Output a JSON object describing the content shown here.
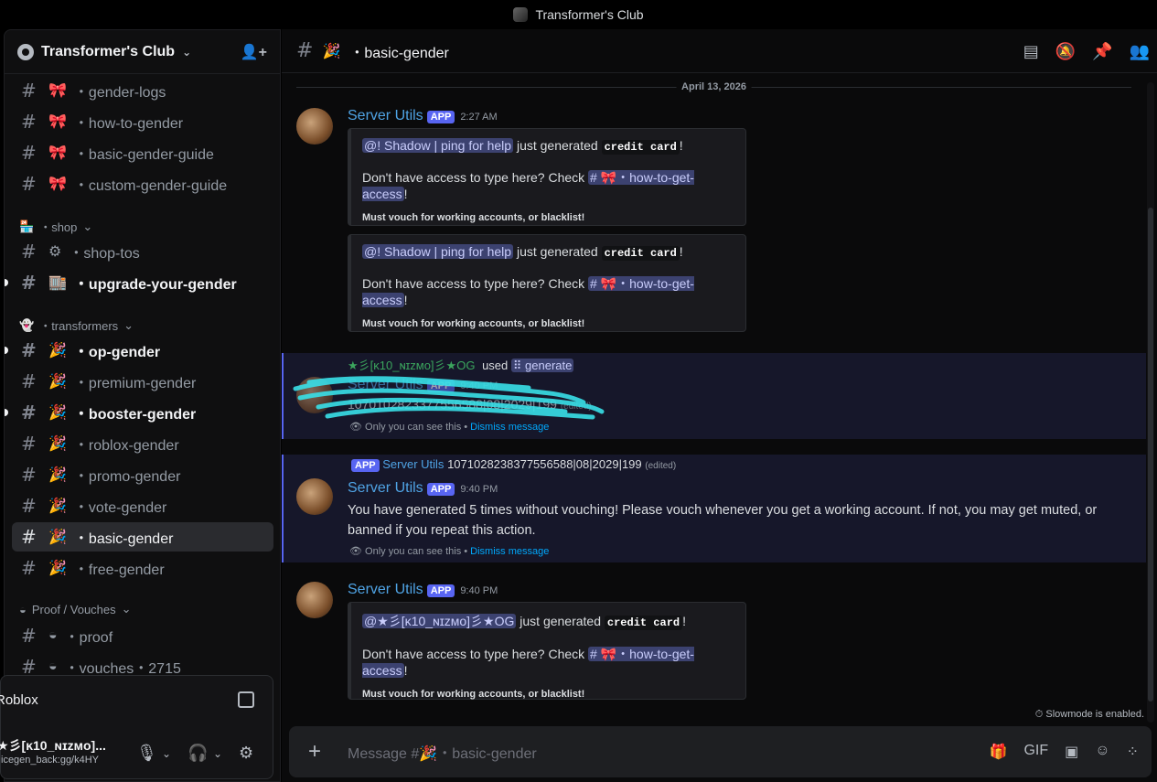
{
  "window": {
    "title": "Transformer's Club"
  },
  "sidebar": {
    "server_name": "Transformer's Club",
    "channels": [
      {
        "emoji": "🎀",
        "label": "・gender-logs"
      },
      {
        "emoji": "🎀",
        "label": "・how-to-gender"
      },
      {
        "emoji": "🎀",
        "label": "・basic-gender-guide"
      },
      {
        "emoji": "🎀",
        "label": "・custom-gender-guide"
      }
    ],
    "cat_shop": "・shop",
    "shop_channels": [
      {
        "emoji": "⚙",
        "label": "・shop-tos"
      },
      {
        "emoji": "🏬",
        "label": "・upgrade-your-gender"
      }
    ],
    "cat_transformers": "・transformers",
    "transformer_channels": [
      {
        "emoji": "🎉",
        "label": "・op-gender"
      },
      {
        "emoji": "🎉",
        "label": "・premium-gender"
      },
      {
        "emoji": "🎉",
        "label": "・booster-gender"
      },
      {
        "emoji": "🎉",
        "label": "・roblox-gender"
      },
      {
        "emoji": "🎉",
        "label": "・promo-gender"
      },
      {
        "emoji": "🎉",
        "label": "・vote-gender"
      },
      {
        "emoji": "🎉",
        "label": "・basic-gender"
      },
      {
        "emoji": "🎉",
        "label": "・free-gender"
      }
    ],
    "cat_proof": "Proof / Vouches",
    "proof_channels": [
      {
        "emoji": "",
        "label": "・proof"
      },
      {
        "emoji": "",
        "label": "・vouches・2715"
      }
    ]
  },
  "user_panel": {
    "activity": "Roblox",
    "username": "★彡[ĸ10_ɴɪᴢᴍᴏ]...",
    "status": "icegen_back:gg/k4HY"
  },
  "channel": {
    "name": "・basic-gender",
    "emoji": "🎉"
  },
  "messages": {
    "date": "April 13, 2026",
    "m1": {
      "author": "Server Utils",
      "badge": "APP",
      "time": "2:27 AM"
    },
    "embed": {
      "mention": "@! Shadow | ping for help",
      "generated": " just generated ",
      "item": "credit card",
      "bang": "!",
      "access_pre": "Don't have access to type here? Check ",
      "access_channel": "# 🎀・how-to-get-access",
      "access_post": "!",
      "warning": "Must vouch for working accounts, or blacklist!"
    },
    "m2": {
      "reply_user": "★彡[ĸ10_ɴɪᴢᴍᴏ]彡★OG",
      "used": "used",
      "command": "generate",
      "author": "Server Utils",
      "badge": "APP",
      "time": "9:40 PM",
      "content": "1070102823377556588|08|2029|199",
      "edited": "(edited)",
      "ephemeral": "Only you can see this • ",
      "dismiss": "Dismiss message"
    },
    "m3": {
      "reply_badge": "APP",
      "reply_author": "Server Utils",
      "reply_text": "1071028238377556588|08|2029|199",
      "reply_edited": "(edited)",
      "author": "Server Utils",
      "badge": "APP",
      "time": "9:40 PM",
      "content": "You have generated 5 times without vouching! Please vouch whenever you get a working account. If not, you may get muted, or banned if you repeat this action.",
      "ephemeral": "Only you can see this • ",
      "dismiss": "Dismiss message"
    },
    "m4": {
      "author": "Server Utils",
      "badge": "APP",
      "time": "9:40 PM",
      "mention": "@★彡[ĸ10_ɴɪᴢᴍᴏ]彡★OG"
    }
  },
  "composer": {
    "placeholder": "Message #🎉・basic-gender",
    "slowmode": "Slowmode is enabled."
  }
}
